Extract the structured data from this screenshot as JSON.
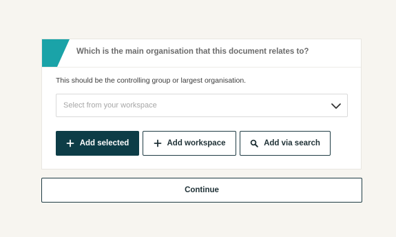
{
  "question_card": {
    "question": "Which is the main organisation that this document relates to?",
    "hint": "This should be the controlling group or largest organisation.",
    "select": {
      "placeholder": "Select from your workspace",
      "icon": "chevron-down-icon"
    },
    "buttons": {
      "add_selected": "Add selected",
      "add_workspace": "Add workspace",
      "add_via_search": "Add via search"
    }
  },
  "continue_label": "Continue",
  "colors": {
    "accent_teal": "#1aa3a8",
    "primary_button": "#0d3d47",
    "background": "#f7f5f0"
  }
}
